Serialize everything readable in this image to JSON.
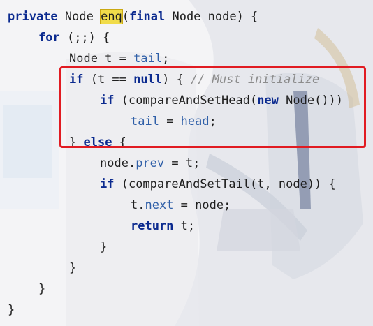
{
  "editor": {
    "lines": [
      {
        "indent": 0,
        "tokens": [
          {
            "t": "private",
            "c": "kw"
          },
          {
            "t": " Node "
          },
          {
            "t": "enq",
            "c": "caret-word"
          },
          {
            "t": "("
          },
          {
            "t": "final",
            "c": "kw"
          },
          {
            "t": " Node node) {"
          }
        ]
      },
      {
        "indent": 1,
        "tokens": [
          {
            "t": "for",
            "c": "kw"
          },
          {
            "t": " (;;) {"
          }
        ]
      },
      {
        "indent": 2,
        "tokens": [
          {
            "t": "Node t = "
          },
          {
            "t": "tail",
            "c": "fld"
          },
          {
            "t": ";"
          }
        ]
      },
      {
        "indent": 2,
        "tokens": [
          {
            "t": "if",
            "c": "kw"
          },
          {
            "t": " (t == "
          },
          {
            "t": "null",
            "c": "kw"
          },
          {
            "t": ") { "
          },
          {
            "t": "// Must initialize",
            "c": "cmt"
          }
        ]
      },
      {
        "indent": 3,
        "tokens": [
          {
            "t": "if",
            "c": "kw"
          },
          {
            "t": " (compareAndSetHead("
          },
          {
            "t": "new",
            "c": "kw"
          },
          {
            "t": " Node()))"
          }
        ]
      },
      {
        "indent": 4,
        "tokens": [
          {
            "t": "tail",
            "c": "fld"
          },
          {
            "t": " = "
          },
          {
            "t": "head",
            "c": "fld"
          },
          {
            "t": ";"
          }
        ]
      },
      {
        "indent": 2,
        "tokens": [
          {
            "t": "} "
          },
          {
            "t": "else",
            "c": "kw"
          },
          {
            "t": " {"
          }
        ]
      },
      {
        "indent": 3,
        "tokens": [
          {
            "t": "node."
          },
          {
            "t": "prev",
            "c": "fld"
          },
          {
            "t": " = t;"
          }
        ]
      },
      {
        "indent": 3,
        "tokens": [
          {
            "t": "if",
            "c": "kw"
          },
          {
            "t": " (compareAndSetTail(t, node)) {"
          }
        ]
      },
      {
        "indent": 4,
        "tokens": [
          {
            "t": "t."
          },
          {
            "t": "next",
            "c": "fld"
          },
          {
            "t": " = node;"
          }
        ]
      },
      {
        "indent": 4,
        "tokens": [
          {
            "t": "return",
            "c": "kw"
          },
          {
            "t": " t;"
          }
        ]
      },
      {
        "indent": 3,
        "tokens": [
          {
            "t": "}"
          }
        ]
      },
      {
        "indent": 2,
        "tokens": [
          {
            "t": "}"
          }
        ]
      },
      {
        "indent": 1,
        "tokens": [
          {
            "t": "}"
          }
        ]
      },
      {
        "indent": 0,
        "tokens": [
          {
            "t": "}"
          }
        ]
      }
    ]
  },
  "annotation": {
    "color": "#e11b22"
  },
  "colors": {
    "keyword": "#0b2a8f",
    "field": "#2f5fa8",
    "comment": "#8c8c8c",
    "caret_highlight": "#f1dc4a"
  }
}
